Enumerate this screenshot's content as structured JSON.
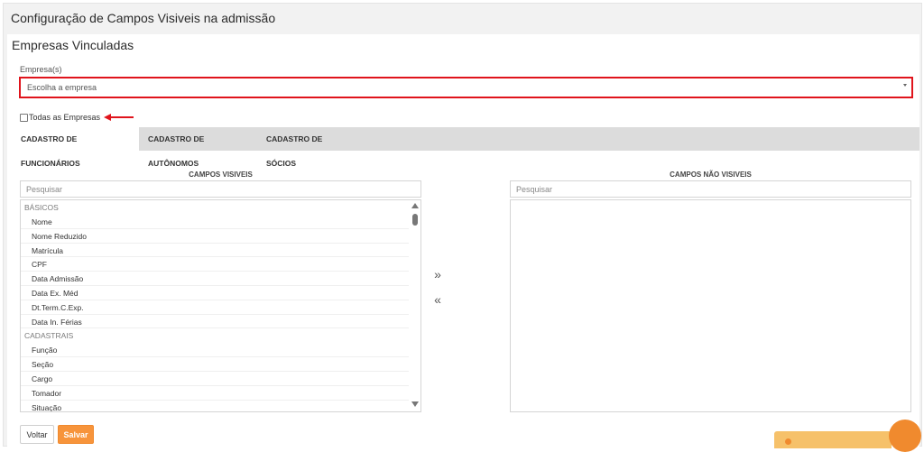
{
  "page": {
    "title": "Configuração de Campos Visiveis na admissão"
  },
  "section": {
    "title": "Empresas Vinculadas"
  },
  "company_field": {
    "label": "Empresa(s)",
    "placeholder": "Escolha a empresa"
  },
  "all_companies": {
    "label": "Todas as Empresas",
    "checked": false
  },
  "tabs": [
    {
      "label": "CADASTRO DE FUNCIONÁRIOS",
      "active": true
    },
    {
      "label": "CADASTRO DE AUTÔNOMOS",
      "active": false
    },
    {
      "label": "CADASTRO DE SÓCIOS",
      "active": false
    }
  ],
  "visible": {
    "title": "CAMPOS VISIVEIS",
    "search_placeholder": "Pesquisar",
    "groups": [
      {
        "name": "BÁSICOS",
        "items": [
          "Nome",
          "Nome Reduzido",
          "Matrícula",
          "CPF",
          "Data Admissão",
          "Data Ex. Méd",
          "Dt.Term.C.Exp.",
          "Data In. Férias"
        ]
      },
      {
        "name": "CADASTRAIS",
        "items": [
          "Função",
          "Seção",
          "Cargo",
          "Tomador",
          "Situação"
        ]
      }
    ]
  },
  "not_visible": {
    "title": "CAMPOS NÃO VISIVEIS",
    "search_placeholder": "Pesquisar"
  },
  "move": {
    "right_icon": "»",
    "left_icon": "«"
  },
  "buttons": {
    "back": "Voltar",
    "save": "Salvar"
  },
  "colors": {
    "highlight": "#e0141c",
    "primary": "#f7943b",
    "tab_bar": "#dcdcdc"
  }
}
